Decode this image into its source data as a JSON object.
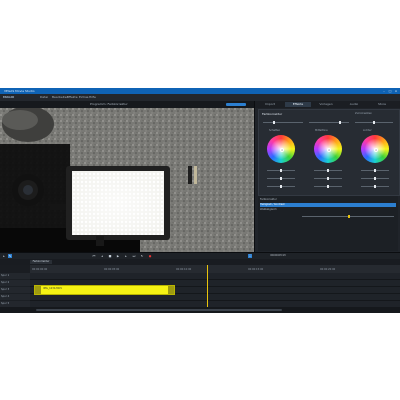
{
  "app": {
    "title": "VEGAS Movie Studio",
    "menu": [
      "Datei",
      "Bearbeiten",
      "Effekte",
      "Extras",
      "Hilfe"
    ],
    "brand": "MAGIX"
  },
  "preview": {
    "caption": "Programm: Farbkorrektur",
    "timecode": "00:00:03:13"
  },
  "right_panel": {
    "tabs": [
      "Import",
      "Effekte",
      "Vorlagen",
      "Audio",
      "Store"
    ],
    "active_tab": "Effekte",
    "effect_title": "Farbkorrektur",
    "wheel_labels": [
      "Schatten",
      "Mitteltöne",
      "Lichter"
    ],
    "reset_label": "Zurücksetzen",
    "list_rows": [
      "Farbkorrektur",
      "Helligkeit / Kontrast",
      "Weißabgleich"
    ]
  },
  "timeline": {
    "tab_label": "Farbkorrektur",
    "track_labels": [
      "Spur 1",
      "Spur 2",
      "Spur 3",
      "Spur 4",
      "Spur 5"
    ],
    "clip_label": "IMG_1234.MOV",
    "ruler_ticks": [
      "00:00:00:00",
      "00:00:05:00",
      "00:00:10:00",
      "00:00:15:00",
      "00:00:20:00"
    ]
  },
  "colors": {
    "accent": "#2c7fd0",
    "clip": "#f6f314",
    "playhead": "#e8c30c"
  }
}
